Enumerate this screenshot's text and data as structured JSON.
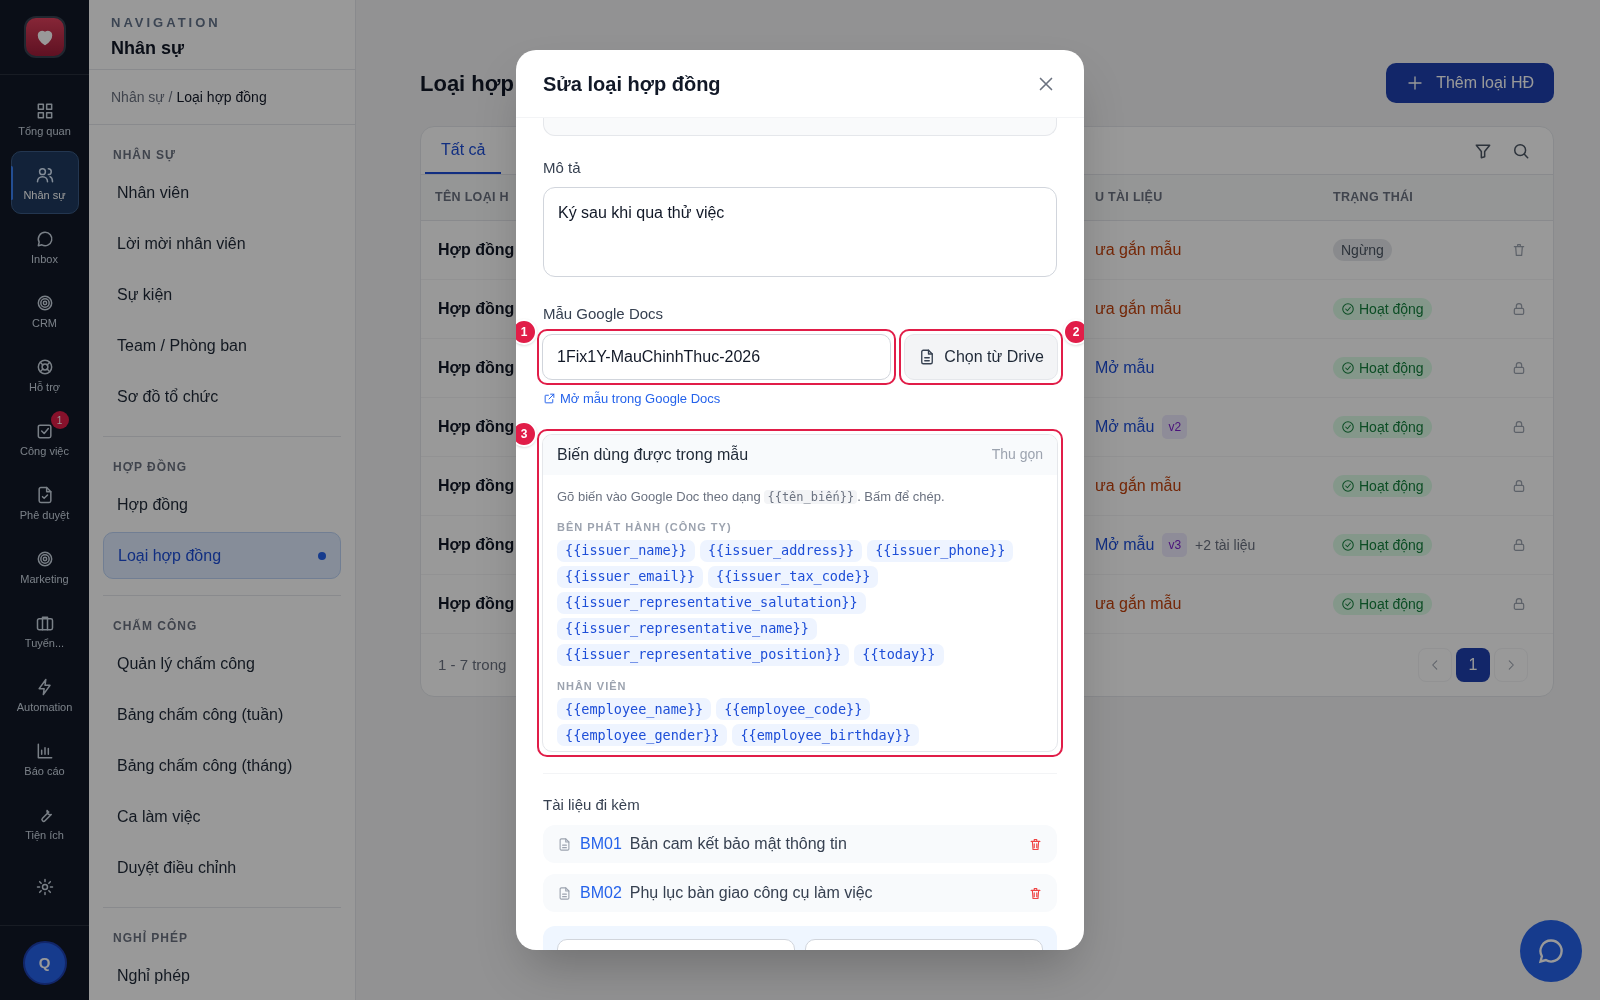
{
  "rail": {
    "items": [
      {
        "label": "Tổng quan",
        "selected": false
      },
      {
        "label": "Nhân sự",
        "selected": true
      },
      {
        "label": "Inbox",
        "selected": false
      },
      {
        "label": "CRM",
        "selected": false
      },
      {
        "label": "Hỗ trợ",
        "selected": false
      },
      {
        "label": "Công việc",
        "selected": false,
        "badge": "1"
      },
      {
        "label": "Phê duyệt",
        "selected": false
      },
      {
        "label": "Marketing",
        "selected": false
      },
      {
        "label": "Tuyển...",
        "selected": false
      },
      {
        "label": "Automation",
        "selected": false
      },
      {
        "label": "Báo cáo",
        "selected": false
      },
      {
        "label": "Tiện ích",
        "selected": false
      },
      {
        "selected": false
      }
    ],
    "avatar": "Q"
  },
  "nav": {
    "heading": "NAVIGATION",
    "title": "Nhân sự",
    "breadcrumb": {
      "parent": "Nhân sự /",
      "current": "Loại hợp đồng"
    },
    "sections": [
      {
        "title": "NHÂN SỰ",
        "items": [
          {
            "label": "Nhân viên",
            "selected": false
          },
          {
            "label": "Lời mời nhân viên",
            "selected": false
          },
          {
            "label": "Sự kiện",
            "selected": false
          },
          {
            "label": "Team / Phòng ban",
            "selected": false
          },
          {
            "label": "Sơ đồ tổ chức",
            "selected": false
          }
        ]
      },
      {
        "title": "HỢP ĐỒNG",
        "items": [
          {
            "label": "Hợp đồng",
            "selected": false
          },
          {
            "label": "Loại hợp đồng",
            "selected": true
          }
        ]
      },
      {
        "title": "CHẤM CÔNG",
        "items": [
          {
            "label": "Quản lý chấm công",
            "selected": false
          },
          {
            "label": "Bảng chấm công (tuần)",
            "selected": false
          },
          {
            "label": "Bảng chấm công (tháng)",
            "selected": false
          },
          {
            "label": "Ca làm việc",
            "selected": false
          },
          {
            "label": "Duyệt điều chỉnh",
            "selected": false
          }
        ]
      },
      {
        "title": "NGHỈ PHÉP",
        "items": [
          {
            "label": "Nghỉ phép",
            "selected": false
          }
        ]
      }
    ]
  },
  "page": {
    "title": "Loại hợp",
    "add_button": "Thêm loại HĐ",
    "tabs": [
      {
        "label": "Tất cả",
        "selected": true
      }
    ],
    "columns": {
      "name": "TÊN LOẠI H",
      "template": "U TÀI LIỆU",
      "status": "TRẠNG THÁI"
    },
    "rows": [
      {
        "name": "Hợp đồng",
        "template": "ưa gắn mẫu",
        "template_linked": false,
        "status": "Ngừng",
        "active": false,
        "deletable": true
      },
      {
        "name": "Hợp đồng",
        "template": "ưa gắn mẫu",
        "template_linked": false,
        "status": "Hoạt động",
        "active": true,
        "deletable": false
      },
      {
        "name": "Hợp đồng",
        "template": "Mở mẫu",
        "template_linked": true,
        "status": "Hoạt động",
        "active": true,
        "deletable": false
      },
      {
        "name": "Hợp đồng",
        "template": "Mở mẫu",
        "template_linked": true,
        "version": "v2",
        "status": "Hoạt động",
        "active": true,
        "deletable": false
      },
      {
        "name": "Hợp đồng",
        "template": "ưa gắn mẫu",
        "template_linked": false,
        "status": "Hoạt động",
        "active": true,
        "deletable": false
      },
      {
        "name": "Hợp đồng",
        "template": "Mở mẫu",
        "template_linked": true,
        "version": "v3",
        "extra": "+2 tài liệu",
        "status": "Hoạt động",
        "active": true,
        "deletable": false
      },
      {
        "name": "Hợp đồng",
        "template": "ưa gắn mẫu",
        "template_linked": false,
        "status": "Hoạt động",
        "active": true,
        "deletable": false
      }
    ],
    "footer": "1 - 7 trong",
    "pages": [
      {
        "label": "1",
        "selected": true
      }
    ]
  },
  "modal": {
    "title": "Sửa loại hợp đồng",
    "description_label": "Mô tả",
    "description": "Ký sau khi qua thử việc",
    "template_label": "Mẫu Google Docs",
    "template_value": "1Fix1Y-MauChinhThuc-2026",
    "drive_button": "Chọn từ Drive",
    "open_link": "Mở mẫu trong Google Docs",
    "annotations": [
      "1",
      "2",
      "3"
    ],
    "variables": {
      "title": "Biến dùng được trong mẫu",
      "collapse": "Thu gọn",
      "hint_before": "Gõ biến vào Google Doc theo dạng",
      "hint_code": "{{tên_biến}}",
      "hint_after": ". Bấm để chép.",
      "groups": [
        {
          "title": "BÊN PHÁT HÀNH (CÔNG TY)",
          "vars": [
            "{{issuer_name}}",
            "{{issuer_address}}",
            "{{issuer_phone}}",
            "{{issuer_email}}",
            "{{issuer_tax_code}}",
            "{{issuer_representative_salutation}}",
            "{{issuer_representative_name}}",
            "{{issuer_representative_position}}",
            "{{today}}"
          ]
        },
        {
          "title": "NHÂN VIÊN",
          "vars": [
            "{{employee_name}}",
            "{{employee_code}}",
            "{{employee_gender}}",
            "{{employee_birthday}}"
          ]
        }
      ]
    },
    "attachments_label": "Tài liệu đi kèm",
    "attachments": [
      {
        "code": "BM01",
        "name": "Bản cam kết bảo mật thông tin"
      },
      {
        "code": "BM02",
        "name": "Phụ lục bàn giao công cụ làm việc"
      }
    ]
  }
}
